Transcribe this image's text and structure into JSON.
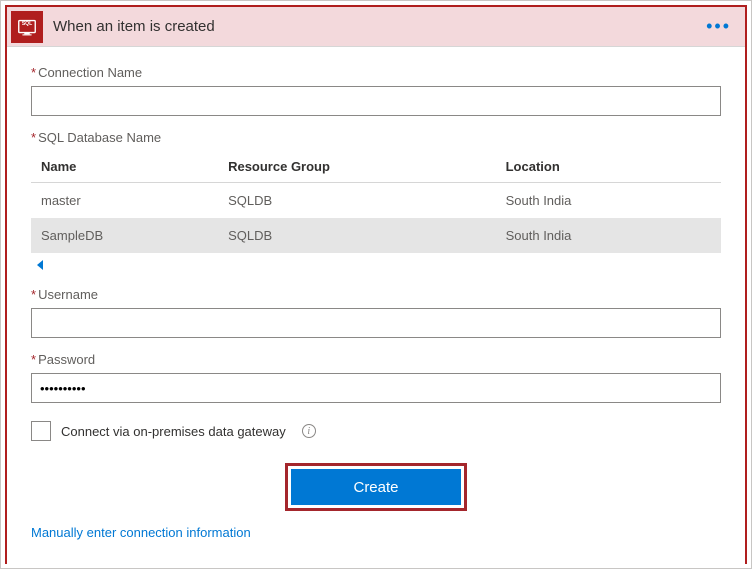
{
  "header": {
    "title": "When an item is created",
    "icon": "sql-icon"
  },
  "fields": {
    "connection_label": "Connection Name",
    "connection_value": "",
    "database_label": "SQL Database Name",
    "username_label": "Username",
    "username_value": "",
    "password_label": "Password",
    "password_value": "••••••••••"
  },
  "table": {
    "columns": {
      "c0": "Name",
      "c1": "Resource Group",
      "c2": "Location"
    },
    "rows": [
      {
        "name": "master",
        "group": "SQLDB",
        "location": "South India",
        "selected": false
      },
      {
        "name": "SampleDB",
        "group": "SQLDB",
        "location": "South India",
        "selected": true
      }
    ]
  },
  "gateway": {
    "label": "Connect via on-premises data gateway",
    "checked": false
  },
  "buttons": {
    "create": "Create"
  },
  "links": {
    "manual": "Manually enter connection information"
  }
}
